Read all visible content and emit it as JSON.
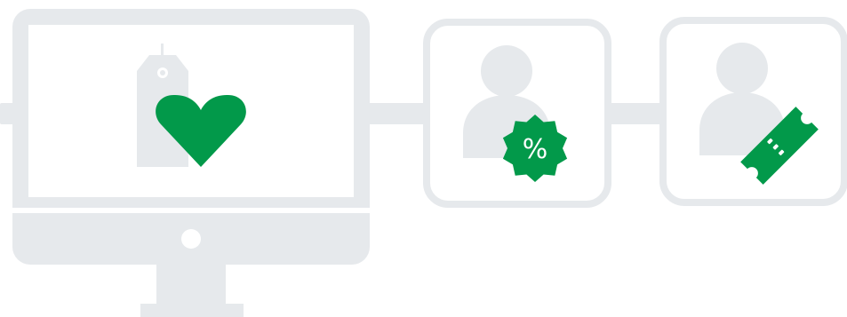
{
  "colors": {
    "outline": "#e6e9ec",
    "accent": "#02994a",
    "background": "#ffffff"
  },
  "icons": [
    "computer-monitor-icon",
    "price-tag-icon",
    "heart-icon",
    "user-silhouette-icon",
    "discount-badge-icon",
    "coupon-ticket-icon"
  ],
  "discount_badge": {
    "symbol": "%"
  }
}
